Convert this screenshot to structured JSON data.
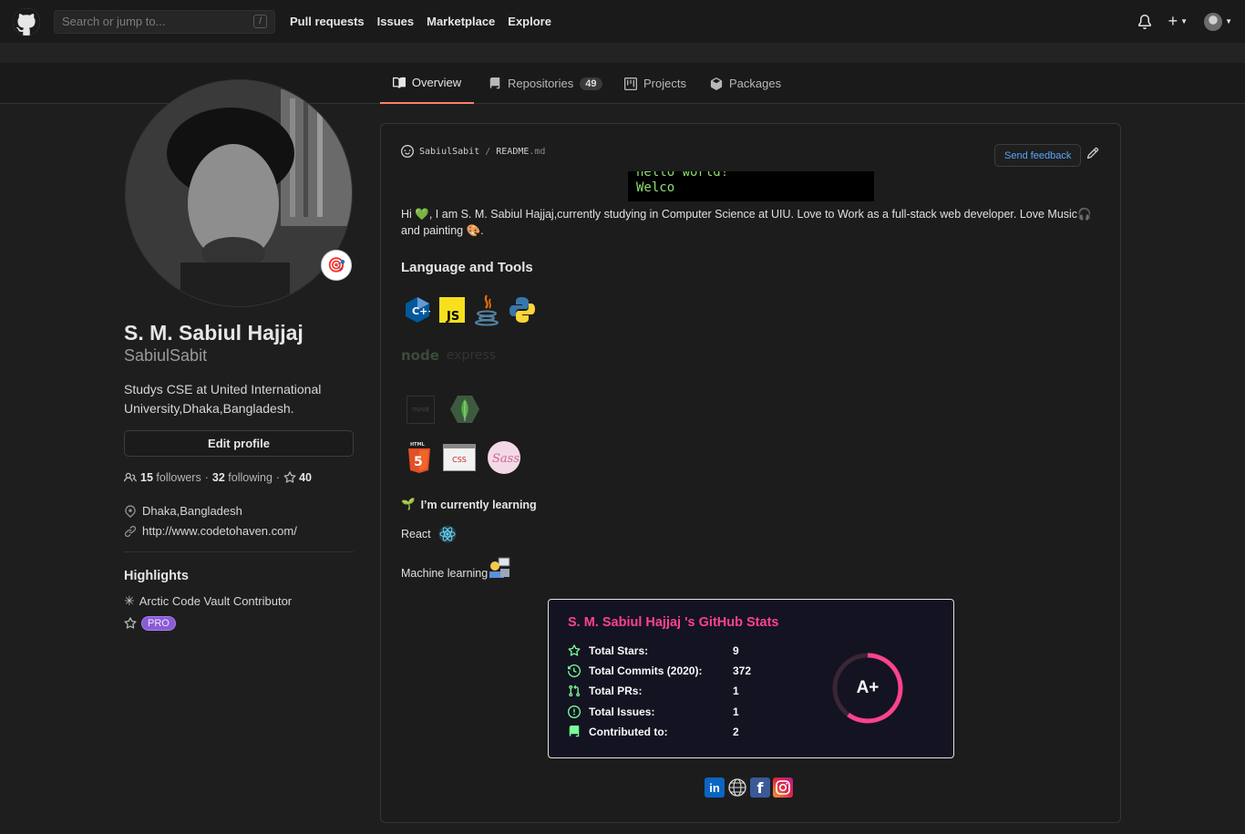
{
  "header": {
    "search_placeholder": "Search or jump to...",
    "search_shortcut": "/",
    "nav": [
      "Pull requests",
      "Issues",
      "Marketplace",
      "Explore"
    ],
    "plus_label": "+"
  },
  "tabs": [
    {
      "label": "Overview",
      "active": true
    },
    {
      "label": "Repositories",
      "count": "49"
    },
    {
      "label": "Projects"
    },
    {
      "label": "Packages"
    }
  ],
  "profile": {
    "status_emoji": "🎯",
    "full_name": "S. M. Sabiul Hajjaj",
    "username": "SabiulSabit",
    "bio": "Studys CSE at United International University,Dhaka,Bangladesh.",
    "edit_label": "Edit profile",
    "followers_count": "15",
    "followers_label": "followers",
    "dot": "·",
    "following_count": "32",
    "following_label": "following",
    "dot2": "·",
    "stars_count": "40",
    "location": "Dhaka,Bangladesh",
    "website": "http://www.codetohaven.com/",
    "highlights_title": "Highlights",
    "highlight_vault": "Arctic Code Vault Contributor",
    "pro_badge": "PRO"
  },
  "readme": {
    "owner": "SabiulSabit",
    "path_sep": "/",
    "file": "README",
    "ext": ".md",
    "feedback_label": "Send feedback",
    "terminal_line1": "hello world!",
    "terminal_line2": "Welco",
    "intro_prefix": "Hi ",
    "intro_heart": "💚",
    "intro_text": ", I am S. M. Sabiul Hajjaj,currently studying in Computer Science at UIU. Love to Work as a full-stack web developer. Love Music",
    "intro_headphone": "🎧",
    "intro_line2": " and painting ",
    "intro_paint": "🎨",
    "intro_end": ".",
    "tools_title": "Language and Tools",
    "tool_cpp": "C++",
    "tool_js": "JS",
    "tool_node": "node",
    "tool_express": "express",
    "tool_mysql": "mysql",
    "tool_html": "HTML",
    "tool_html_num": "5",
    "tool_css": "CSS",
    "tool_sass": "Sass",
    "learning_emoji": "🌱",
    "learning_title": "I’m currently learning",
    "learn_react": "React",
    "learn_ml": "Machine learning"
  },
  "stats": {
    "title": "S. M. Sabiul Hajjaj 's GitHub Stats",
    "rows": [
      {
        "label": "Total Stars:",
        "value": "9"
      },
      {
        "label": "Total Commits (2020):",
        "value": "372"
      },
      {
        "label": "Total PRs:",
        "value": "1"
      },
      {
        "label": "Total Issues:",
        "value": "1"
      },
      {
        "label": "Contributed to:",
        "value": "2"
      }
    ],
    "grade": "A+",
    "grade_progress": 0.6,
    "title_color": "#fe428e",
    "icon_color": "#79ff97",
    "ring_color": "#fe428e"
  },
  "socials": {
    "linkedin": "in",
    "facebook": "f"
  }
}
